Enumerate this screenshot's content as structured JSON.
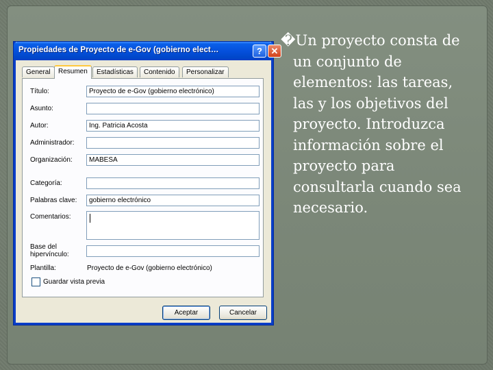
{
  "dialog": {
    "title": "Propiedades de Proyecto de e-Gov (gobierno elect…",
    "help_button": "?",
    "close_button": "✕",
    "tabs": [
      {
        "label": "General"
      },
      {
        "label": "Resumen",
        "active": true
      },
      {
        "label": "Estadísticas"
      },
      {
        "label": "Contenido"
      },
      {
        "label": "Personalizar"
      }
    ],
    "fields": {
      "titulo": {
        "label": "Título:",
        "value": "Proyecto de e-Gov (gobierno electrónico)"
      },
      "asunto": {
        "label": "Asunto:",
        "value": ""
      },
      "autor": {
        "label": "Autor:",
        "value": "Ing. Patricia Acosta"
      },
      "administrador": {
        "label": "Administrador:",
        "value": ""
      },
      "organizacion": {
        "label": "Organización:",
        "value": "MABESA"
      },
      "categoria": {
        "label": "Categoría:",
        "value": ""
      },
      "palabras_clave": {
        "label": "Palabras clave:",
        "value": "gobierno electrónico"
      },
      "comentarios": {
        "label": "Comentarios:",
        "value": ""
      },
      "base_hipervinculo": {
        "label_line1": "Base del",
        "label_line2": "hipervínculo:",
        "value": ""
      },
      "plantilla": {
        "label": "Plantilla:",
        "value": "Proyecto de e-Gov (gobierno electrónico)"
      }
    },
    "checkbox": {
      "label": "Guardar vista previa",
      "checked": false
    },
    "buttons": {
      "ok": "Aceptar",
      "cancel": "Cancelar"
    }
  },
  "slide": {
    "bullet_symbol": "�",
    "bullet_lines": [
      "Un proyecto consta de",
      "un conjunto de",
      "elementos: las tareas,",
      "las y los objetivos del",
      "proyecto. Introduzca",
      "información sobre el",
      "proyecto para",
      "consultarla cuando sea",
      "necesario."
    ]
  },
  "colors": {
    "slide_background": "#7c8879",
    "titlebar_blue": "#0550dc",
    "dialog_face": "#ece9d8",
    "text_white": "#ffffff"
  }
}
